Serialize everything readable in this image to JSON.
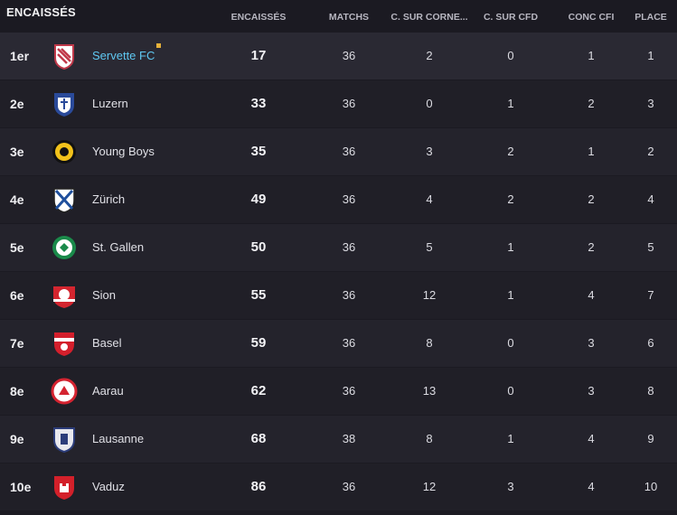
{
  "title": "ENCAISSÉS",
  "columns": {
    "encaisses": "ENCAISSÉS",
    "matchs": "MATCHS",
    "corners": "C. SUR CORNE...",
    "cfd": "C. SUR CFD",
    "cfi": "CONC CFI",
    "place": "PLACE"
  },
  "rows": [
    {
      "rank": "1er",
      "team": "Servette FC",
      "encaisses": "17",
      "matchs": "36",
      "corners": "2",
      "cfd": "0",
      "cfi": "1",
      "place": "1",
      "crest": "servette-crest-icon",
      "color": "#c0394a"
    },
    {
      "rank": "2e",
      "team": "Luzern",
      "encaisses": "33",
      "matchs": "36",
      "corners": "0",
      "cfd": "1",
      "cfi": "2",
      "place": "3",
      "crest": "luzern-crest-icon",
      "color": "#2a4a9a"
    },
    {
      "rank": "3e",
      "team": "Young Boys",
      "encaisses": "35",
      "matchs": "36",
      "corners": "3",
      "cfd": "2",
      "cfi": "1",
      "place": "2",
      "crest": "young-boys-crest-icon",
      "color": "#f2c21b"
    },
    {
      "rank": "4e",
      "team": "Zürich",
      "encaisses": "49",
      "matchs": "36",
      "corners": "4",
      "cfd": "2",
      "cfi": "2",
      "place": "4",
      "crest": "zurich-crest-icon",
      "color": "#1f4f9c"
    },
    {
      "rank": "5e",
      "team": "St. Gallen",
      "encaisses": "50",
      "matchs": "36",
      "corners": "5",
      "cfd": "1",
      "cfi": "2",
      "place": "5",
      "crest": "st-gallen-crest-icon",
      "color": "#1a8a4a"
    },
    {
      "rank": "6e",
      "team": "Sion",
      "encaisses": "55",
      "matchs": "36",
      "corners": "12",
      "cfd": "1",
      "cfi": "4",
      "place": "7",
      "crest": "sion-crest-icon",
      "color": "#d4252f"
    },
    {
      "rank": "7e",
      "team": "Basel",
      "encaisses": "59",
      "matchs": "36",
      "corners": "8",
      "cfd": "0",
      "cfi": "3",
      "place": "6",
      "crest": "basel-crest-icon",
      "color": "#d41f2c"
    },
    {
      "rank": "8e",
      "team": "Aarau",
      "encaisses": "62",
      "matchs": "36",
      "corners": "13",
      "cfd": "0",
      "cfi": "3",
      "place": "8",
      "crest": "aarau-crest-icon",
      "color": "#d42330"
    },
    {
      "rank": "9e",
      "team": "Lausanne",
      "encaisses": "68",
      "matchs": "38",
      "corners": "8",
      "cfd": "1",
      "cfi": "4",
      "place": "9",
      "crest": "lausanne-crest-icon",
      "color": "#2c3d7a"
    },
    {
      "rank": "10e",
      "team": "Vaduz",
      "encaisses": "86",
      "matchs": "36",
      "corners": "12",
      "cfd": "3",
      "cfi": "4",
      "place": "10",
      "crest": "vaduz-crest-icon",
      "color": "#d3202a"
    }
  ]
}
